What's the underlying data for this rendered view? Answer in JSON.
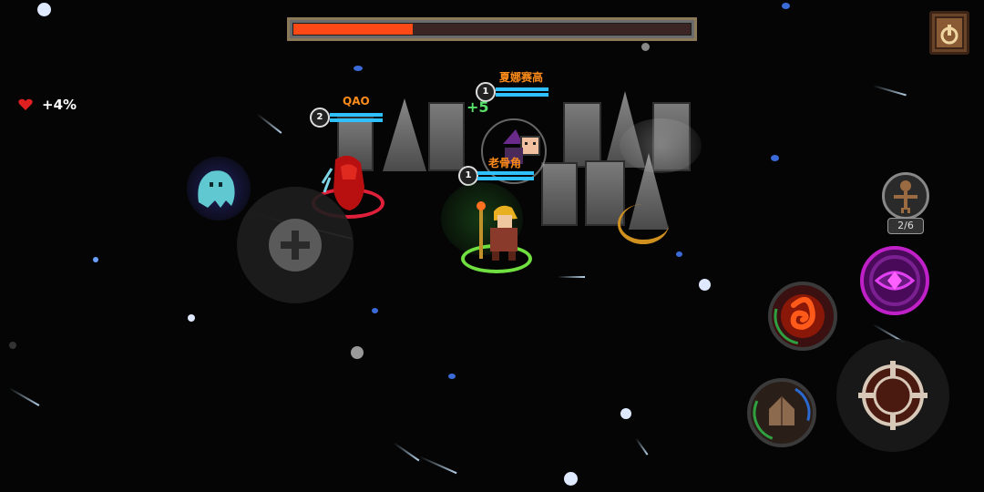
{
  "boss_bar": {
    "fill_fraction": 0.3,
    "fill_color": "#ff4a17"
  },
  "pause_button": {
    "icon": "pause-icon"
  },
  "player_status": {
    "heart_icon": "heart-icon",
    "text": "+4%"
  },
  "players": [
    {
      "name": "QAO",
      "level": "2",
      "name_color": "#ff8c1a"
    },
    {
      "name": "夏娜赛高",
      "level": "1",
      "name_color": "#ff8c1a",
      "heal_text": "+5",
      "heal_color": "#58e06a"
    },
    {
      "name": "老骨角",
      "level": "1",
      "name_color": "#ff8c1a"
    }
  ],
  "summon": {
    "icon": "scarecrow-icon",
    "count_text": "2/6"
  },
  "skills": [
    {
      "name": "fire-swirl-skill",
      "color": "#ff4a17"
    },
    {
      "name": "purple-eye-skill",
      "color": "#c020c8"
    },
    {
      "name": "rock-shield-skill",
      "color": "#8b6a4e"
    },
    {
      "name": "attack-crosshair",
      "color": "#d8c8b8"
    }
  ]
}
